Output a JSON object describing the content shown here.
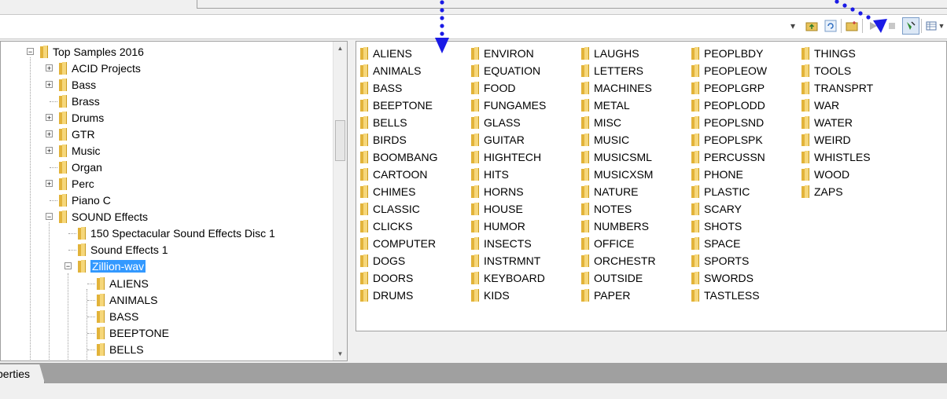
{
  "toolbar": {
    "icons": [
      "dropdown-arrow",
      "up-folder",
      "refresh",
      "new-folder",
      "play",
      "auto-preview",
      "view-mode"
    ]
  },
  "tree": {
    "root": "Top Samples 2016",
    "children": [
      "ACID Projects",
      "Bass",
      "Brass",
      "Drums",
      "GTR",
      "Music",
      "Organ",
      "Perc",
      "Piano C",
      "SOUND Effects"
    ],
    "sound_effects_children": [
      "150 Spectacular Sound Effects Disc 1",
      "Sound Effects 1",
      "Zillion-wav"
    ],
    "zillion_children": [
      "ALIENS",
      "ANIMALS",
      "BASS",
      "BEEPTONE",
      "BELLS"
    ]
  },
  "files": {
    "col1": [
      "ALIENS",
      "ANIMALS",
      "BASS",
      "BEEPTONE",
      "BELLS",
      "BIRDS",
      "BOOMBANG",
      "CARTOON",
      "CHIMES",
      "CLASSIC",
      "CLICKS",
      "COMPUTER",
      "DOGS",
      "DOORS",
      "DRUMS"
    ],
    "col2": [
      "ENVIRON",
      "EQUATION",
      "FOOD",
      "FUNGAMES",
      "GLASS",
      "GUITAR",
      "HIGHTECH",
      "HITS",
      "HORNS",
      "HOUSE",
      "HUMOR",
      "INSECTS",
      "INSTRMNT",
      "KEYBOARD",
      "KIDS"
    ],
    "col3": [
      "LAUGHS",
      "LETTERS",
      "MACHINES",
      "METAL",
      "MISC",
      "MUSIC",
      "MUSICSML",
      "MUSICXSM",
      "NATURE",
      "NOTES",
      "NUMBERS",
      "OFFICE",
      "ORCHESTR",
      "OUTSIDE",
      "PAPER"
    ],
    "col4": [
      "PEOPLBDY",
      "PEOPLEOW",
      "PEOPLGRP",
      "PEOPLODD",
      "PEOPLSND",
      "PEOPLSPK",
      "PERCUSSN",
      "PHONE",
      "PLASTIC",
      "SCARY",
      "SHOTS",
      "SPACE",
      "SPORTS",
      "SWORDS",
      "TASTLESS"
    ],
    "col5": [
      "THINGS",
      "TOOLS",
      "TRANSPRT",
      "WAR",
      "WATER",
      "WEIRD",
      "WHISTLES",
      "WOOD",
      "ZAPS"
    ]
  },
  "tabs": {
    "properties": "perties"
  },
  "colors": {
    "selection": "#3399ff",
    "annotation_arrow": "#1a1ae6"
  }
}
